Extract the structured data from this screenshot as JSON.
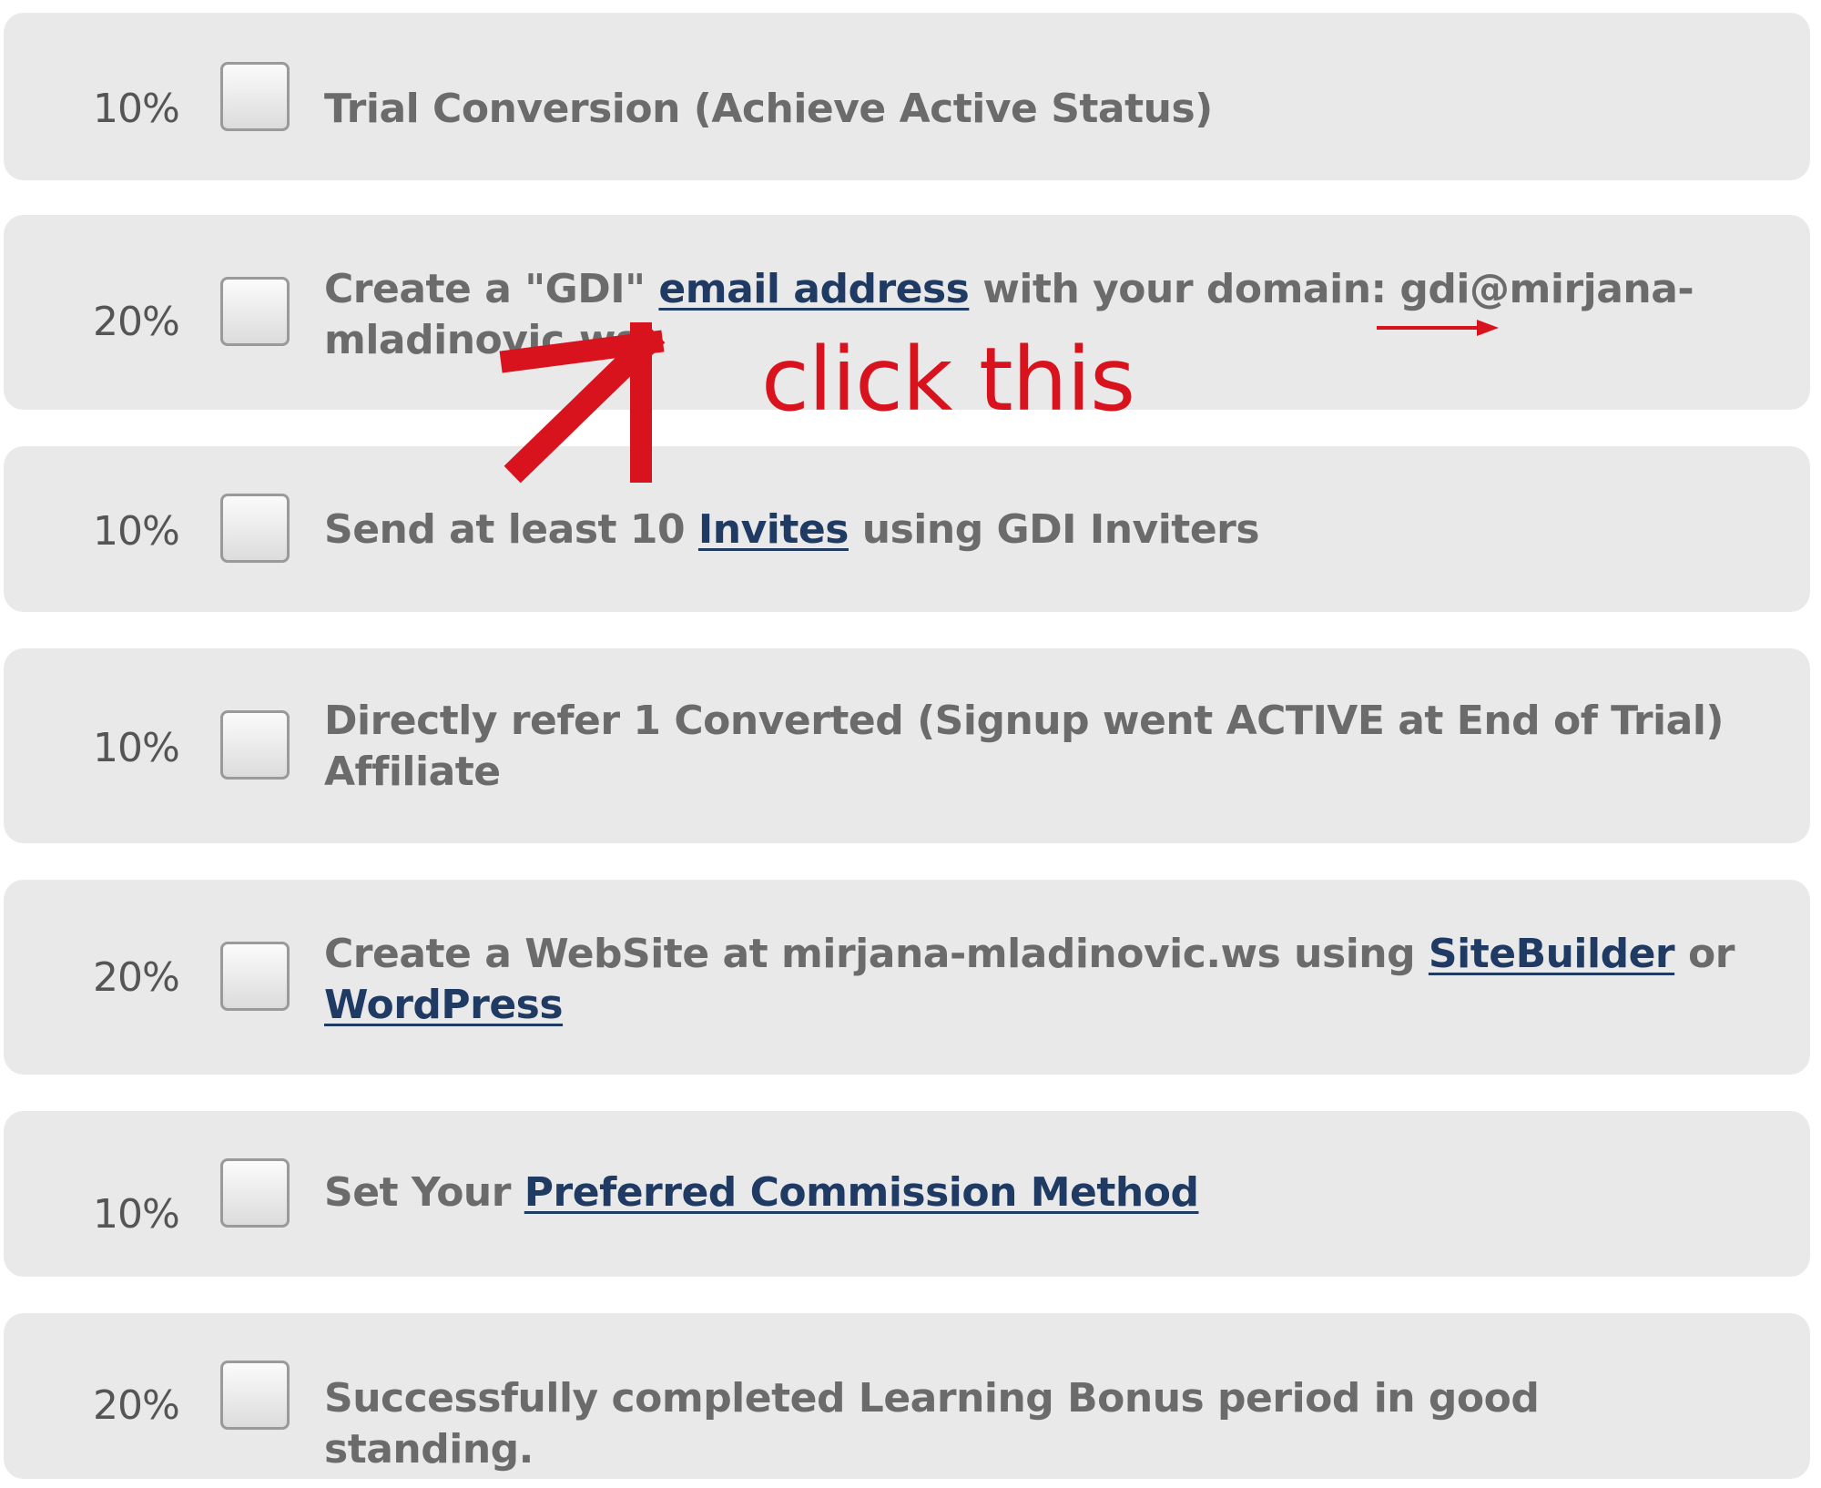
{
  "tasks": [
    {
      "percent": "10%",
      "parts": [
        {
          "text": "Trial Conversion (Achieve Active Status)",
          "link": false
        }
      ]
    },
    {
      "percent": "20%",
      "parts": [
        {
          "text": "Create a \"GDI\" ",
          "link": false
        },
        {
          "text": "email address",
          "link": true
        },
        {
          "text": " with your domain: gdi@mirjana-mladinovic.ws",
          "link": false
        }
      ]
    },
    {
      "percent": "10%",
      "parts": [
        {
          "text": "Send at least 10 ",
          "link": false
        },
        {
          "text": "Invites",
          "link": true
        },
        {
          "text": " using GDI Inviters",
          "link": false
        }
      ]
    },
    {
      "percent": "10%",
      "parts": [
        {
          "text": "Directly refer 1 Converted (Signup went ACTIVE at End of Trial) Affiliate",
          "link": false
        }
      ]
    },
    {
      "percent": "20%",
      "parts": [
        {
          "text": "Create a WebSite at mirjana-mladinovic.ws using ",
          "link": false
        },
        {
          "text": "SiteBuilder",
          "link": true
        },
        {
          "text": " or ",
          "link": false
        },
        {
          "text": "WordPress",
          "link": true
        }
      ]
    },
    {
      "percent": "10%",
      "parts": [
        {
          "text": "Set Your ",
          "link": false
        },
        {
          "text": "Preferred Commission Method",
          "link": true
        }
      ]
    },
    {
      "percent": "20%",
      "parts": [
        {
          "text": "Successfully completed Learning Bonus period in good standing.",
          "link": false
        }
      ]
    }
  ],
  "annotation": {
    "label": "click this",
    "color": "#d8131e"
  },
  "colors": {
    "row_background": "#e9e9e9",
    "text": "#6b6b6b",
    "link": "#1f3a63"
  }
}
